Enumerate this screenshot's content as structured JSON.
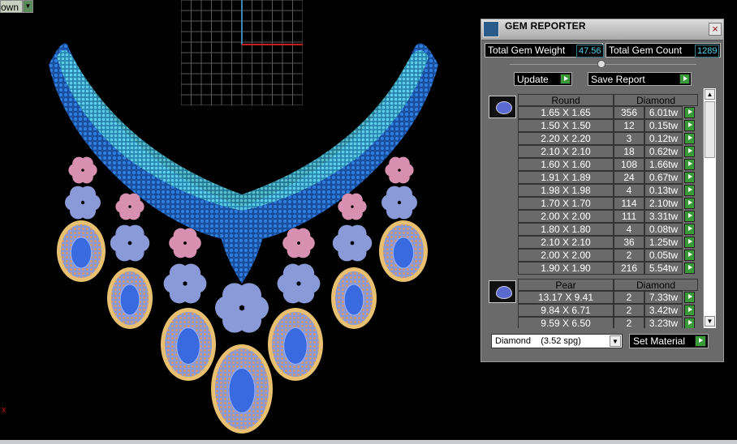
{
  "view_dropdown": {
    "label": "own"
  },
  "axis_marker": "x",
  "panel": {
    "title": "GEM REPORTER",
    "close_label": "×",
    "total_weight_label": "Total Gem Weight",
    "total_weight_value": "47.56",
    "total_count_label": "Total Gem Count",
    "total_count_value": "1289",
    "update_label": "Update",
    "save_label": "Save Report",
    "groups": [
      {
        "shape": "Round",
        "material": "Diamond",
        "icon": "round-gem-icon",
        "rows": [
          {
            "size": "1.65 X 1.65",
            "count": "356",
            "weight": "6.01tw"
          },
          {
            "size": "1.50 X 1.50",
            "count": "12",
            "weight": "0.15tw"
          },
          {
            "size": "2.20 X 2.20",
            "count": "3",
            "weight": "0.12tw"
          },
          {
            "size": "2.10 X 2.10",
            "count": "18",
            "weight": "0.62tw"
          },
          {
            "size": "1.60 X 1.60",
            "count": "108",
            "weight": "1.66tw"
          },
          {
            "size": "1.91 X 1.89",
            "count": "24",
            "weight": "0.67tw"
          },
          {
            "size": "1.98 X 1.98",
            "count": "4",
            "weight": "0.13tw"
          },
          {
            "size": "1.70 X 1.70",
            "count": "114",
            "weight": "2.10tw"
          },
          {
            "size": "2.00 X 2.00",
            "count": "111",
            "weight": "3.31tw"
          },
          {
            "size": "1.80 X 1.80",
            "count": "4",
            "weight": "0.08tw"
          },
          {
            "size": "2.10 X 2.10",
            "count": "36",
            "weight": "1.25tw"
          },
          {
            "size": "2.00 X 2.00",
            "count": "2",
            "weight": "0.05tw"
          },
          {
            "size": "1.90 X 1.90",
            "count": "216",
            "weight": "5.54tw"
          }
        ]
      },
      {
        "shape": "Pear",
        "material": "Diamond",
        "icon": "pear-gem-icon",
        "rows": [
          {
            "size": "13.17 X 9.41",
            "count": "2",
            "weight": "7.33tw"
          },
          {
            "size": "9.84 X 6.71",
            "count": "2",
            "weight": "3.42tw"
          },
          {
            "size": "9.59 X 6.50",
            "count": "2",
            "weight": "3.23tw"
          }
        ]
      }
    ],
    "material_select": "Diamond    (3.52 spg)",
    "set_material_label": "Set Material"
  },
  "colors": {
    "accent_green": "#3a9a3a",
    "value_cyan": "#50d0f0",
    "necklace_blue": "#1f5fbf",
    "necklace_cyan": "#4fd0e0",
    "gold": "#e8c070",
    "pink": "#e890b0"
  }
}
